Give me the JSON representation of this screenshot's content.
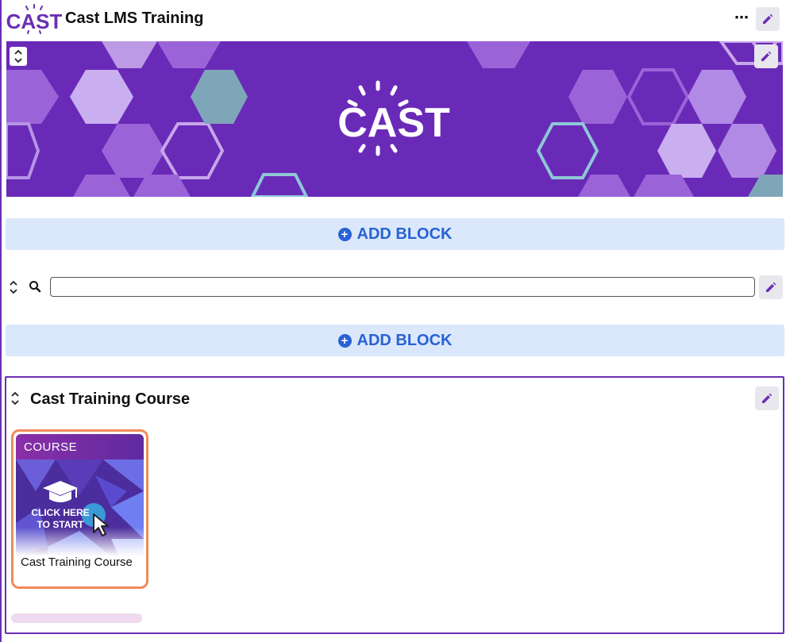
{
  "header": {
    "logo_text": "CAST",
    "title": "Cast LMS Training",
    "more_label": "⋯",
    "edit_icon": "pencil-icon"
  },
  "banner": {
    "logo_text": "CAST",
    "collapse_icon": "chevron-up-down-icon"
  },
  "add_block": {
    "label": "ADD BLOCK",
    "icon": "plus-circle-icon"
  },
  "search": {
    "value": "",
    "placeholder": "",
    "icon": "search-icon"
  },
  "course_section": {
    "title": "Cast Training Course",
    "card": {
      "badge": "COURSE",
      "image_text_line1": "CLICK HERE",
      "image_text_line2": "TO START",
      "name": "Cast Training Course"
    }
  },
  "colors": {
    "brand_purple": "#6a2fb3",
    "banner_bg": "#6a2ab8",
    "add_block_bg": "#dbe8fb",
    "add_block_text": "#2862d4",
    "highlight": "#f08a5a"
  }
}
